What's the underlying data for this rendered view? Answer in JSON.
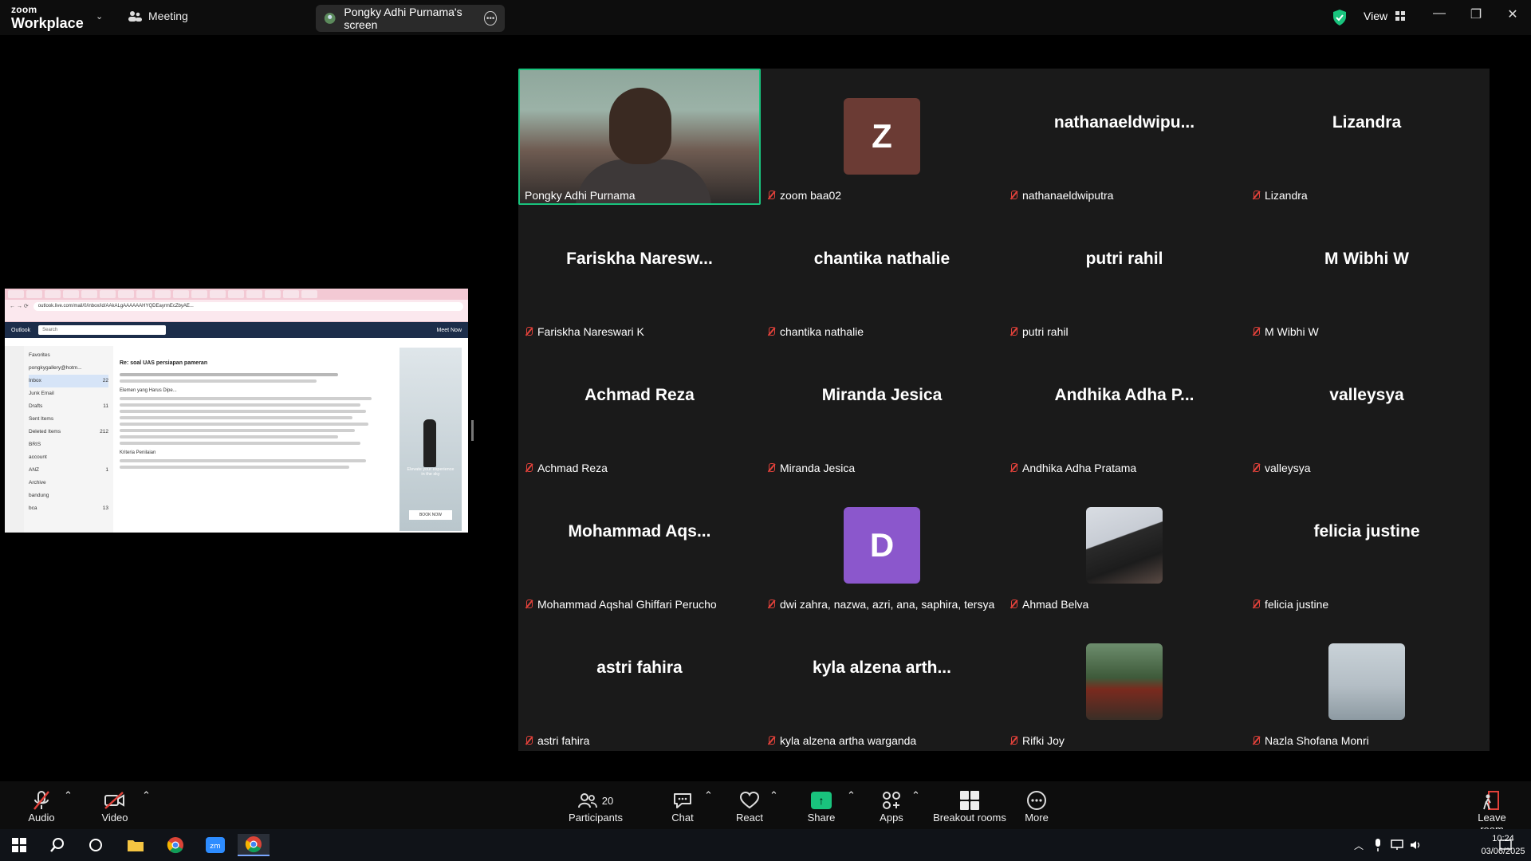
{
  "titlebar": {
    "brand_top": "zoom",
    "brand_bottom": "Workplace",
    "meeting_label": "Meeting",
    "share_pill_label": "Pongky Adhi Purnama's screen",
    "view_label": "View"
  },
  "shared_screen": {
    "url": "outlook.live.com/mail/0/inbox/id/AAkALgAAAAAAHYQDEayrmEcZbyAE...",
    "search": "Search",
    "app": "Outlook",
    "meet_now": "Meet Now",
    "folders": [
      {
        "name": "Favorites",
        "count": ""
      },
      {
        "name": "pongkygallery@hotm...",
        "count": ""
      },
      {
        "name": "Inbox",
        "count": "22"
      },
      {
        "name": "Junk Email",
        "count": ""
      },
      {
        "name": "Drafts",
        "count": "11"
      },
      {
        "name": "Sent Items",
        "count": ""
      },
      {
        "name": "Deleted Items",
        "count": "212"
      },
      {
        "name": "BRIS",
        "count": ""
      },
      {
        "name": "account",
        "count": ""
      },
      {
        "name": "ANZ",
        "count": "1"
      },
      {
        "name": "Archive",
        "count": ""
      },
      {
        "name": "bandung",
        "count": ""
      },
      {
        "name": "bca",
        "count": "13"
      }
    ],
    "subject": "Re: soal UAS persiapan pameran",
    "section1": "Elemen yang Harus Dipe...",
    "section2": "Kriteria Penilaian",
    "ad_text": "Elevate your experience in the sky",
    "ad_button": "BOOK NOW"
  },
  "participants_tiles": [
    {
      "display": "",
      "label": "Pongky Adhi Purnama",
      "type": "video",
      "muted": false
    },
    {
      "display": "Z",
      "label": "zoom baa02",
      "type": "avatar-z",
      "muted": true
    },
    {
      "display": "nathanaeldwipu...",
      "label": "nathanaeldwiputra",
      "type": "name",
      "muted": true
    },
    {
      "display": "Lizandra",
      "label": "Lizandra",
      "type": "name",
      "muted": true
    },
    {
      "display": "Fariskha  Naresw...",
      "label": "Fariskha Nareswari K",
      "type": "name",
      "muted": true
    },
    {
      "display": "chantika nathalie",
      "label": "chantika nathalie",
      "type": "name",
      "muted": true
    },
    {
      "display": "putri rahil",
      "label": "putri rahil",
      "type": "name",
      "muted": true
    },
    {
      "display": "M Wibhi W",
      "label": "M Wibhi W",
      "type": "name",
      "muted": true
    },
    {
      "display": "Achmad Reza",
      "label": "Achmad Reza",
      "type": "name",
      "muted": true
    },
    {
      "display": "Miranda Jesica",
      "label": "Miranda Jesica",
      "type": "name",
      "muted": true
    },
    {
      "display": "Andhika Adha P...",
      "label": "Andhika Adha Pratama",
      "type": "name",
      "muted": true
    },
    {
      "display": "valleysya",
      "label": "valleysya",
      "type": "name",
      "muted": true
    },
    {
      "display": "Mohammad  Aqs...",
      "label": "Mohammad Aqshal Ghiffari Perucho",
      "type": "name",
      "muted": true
    },
    {
      "display": "D",
      "label": "dwi zahra, nazwa, azri, ana, saphira, tersya",
      "type": "avatar-d",
      "muted": true
    },
    {
      "display": "",
      "label": "Ahmad Belva",
      "type": "photo1",
      "muted": true
    },
    {
      "display": "felicia justine",
      "label": "felicia justine",
      "type": "name",
      "muted": true
    },
    {
      "display": "astri fahira",
      "label": "astri fahira",
      "type": "name",
      "muted": true
    },
    {
      "display": "kyla alzena arth...",
      "label": "kyla alzena artha warganda",
      "type": "name",
      "muted": true
    },
    {
      "display": "",
      "label": "Rifki Joy",
      "type": "photo2",
      "muted": true
    },
    {
      "display": "",
      "label": "Nazla Shofana Monri",
      "type": "photo3",
      "muted": true
    }
  ],
  "toolbar": {
    "audio": "Audio",
    "video": "Video",
    "participants_count": "20",
    "participants": "Participants",
    "chat": "Chat",
    "react": "React",
    "share": "Share",
    "apps": "Apps",
    "breakout": "Breakout rooms",
    "more": "More",
    "leave": "Leave room"
  },
  "taskbar": {
    "time": "10:24",
    "date": "03/06/2025"
  },
  "colors": {
    "active_speaker": "#19c37d",
    "mute_red": "#e0413a",
    "share_green": "#19c37d",
    "gallery_bg": "#1a1a1a"
  }
}
